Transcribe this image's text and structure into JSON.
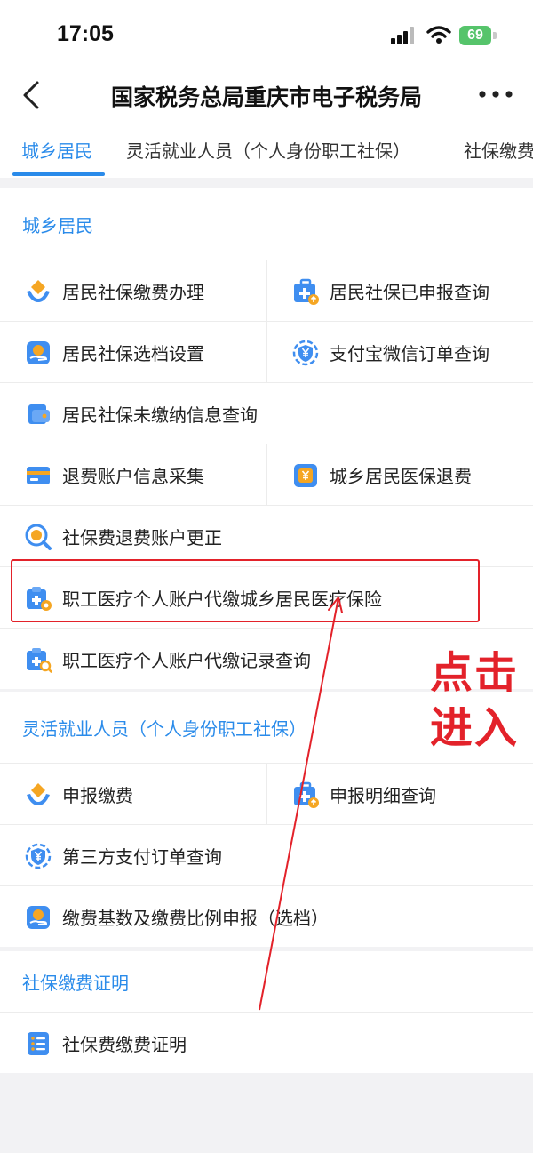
{
  "status_bar": {
    "time": "17:05",
    "battery": "69"
  },
  "nav": {
    "title": "国家税务总局重庆市电子税务局"
  },
  "tabs": [
    {
      "label": "城乡居民",
      "active": true
    },
    {
      "label": "灵活就业人员（个人身份职工社保）",
      "active": false
    },
    {
      "label": "社保缴费",
      "active": false
    }
  ],
  "sections": {
    "residents": {
      "title": "城乡居民",
      "items": {
        "social_insurance_payment": {
          "label": "居民社保缴费办理",
          "icon": "hands-diamond-icon"
        },
        "declared_query": {
          "label": "居民社保已申报查询",
          "icon": "medical-kit-icon"
        },
        "tier_settings": {
          "label": "居民社保选档设置",
          "icon": "hand-coin-icon"
        },
        "alipay_wechat_query": {
          "label": "支付宝微信订单查询",
          "icon": "yen-shield-icon"
        },
        "unpaid_query": {
          "label": "居民社保未缴纳信息查询",
          "icon": "wallet-icon"
        },
        "refund_account_collect": {
          "label": "退费账户信息采集",
          "icon": "card-icon"
        },
        "medical_refund": {
          "label": "城乡居民医保退费",
          "icon": "yen-box-icon"
        },
        "refund_account_correct": {
          "label": "社保费退费账户更正",
          "icon": "search-coin-icon"
        },
        "employee_account_pay": {
          "label": "职工医疗个人账户代缴城乡居民医疗保险",
          "icon": "medical-clipboard-coin-icon"
        },
        "employee_account_record": {
          "label": "职工医疗个人账户代缴记录查询",
          "icon": "medical-clipboard-search-icon"
        }
      }
    },
    "flexible": {
      "title": "灵活就业人员（个人身份职工社保）",
      "items": {
        "declare_pay": {
          "label": "申报缴费",
          "icon": "hands-diamond-icon"
        },
        "declare_detail": {
          "label": "申报明细查询",
          "icon": "medical-kit-icon"
        },
        "third_party_query": {
          "label": "第三方支付订单查询",
          "icon": "yen-shield-icon"
        },
        "base_ratio_declare": {
          "label": "缴费基数及缴费比例申报（选档）",
          "icon": "hand-coin-icon"
        }
      }
    },
    "certificate": {
      "title": "社保缴费证明",
      "items": {
        "payment_certificate": {
          "label": "社保费缴费证明",
          "icon": "document-list-icon"
        }
      }
    }
  },
  "annotation": {
    "text": "点击进入",
    "color": "#e3222a"
  },
  "colors": {
    "accent": "#2a8bea",
    "icon_blue": "#3f8ef0",
    "icon_orange": "#f5a623",
    "annotation_red": "#e3222a"
  }
}
